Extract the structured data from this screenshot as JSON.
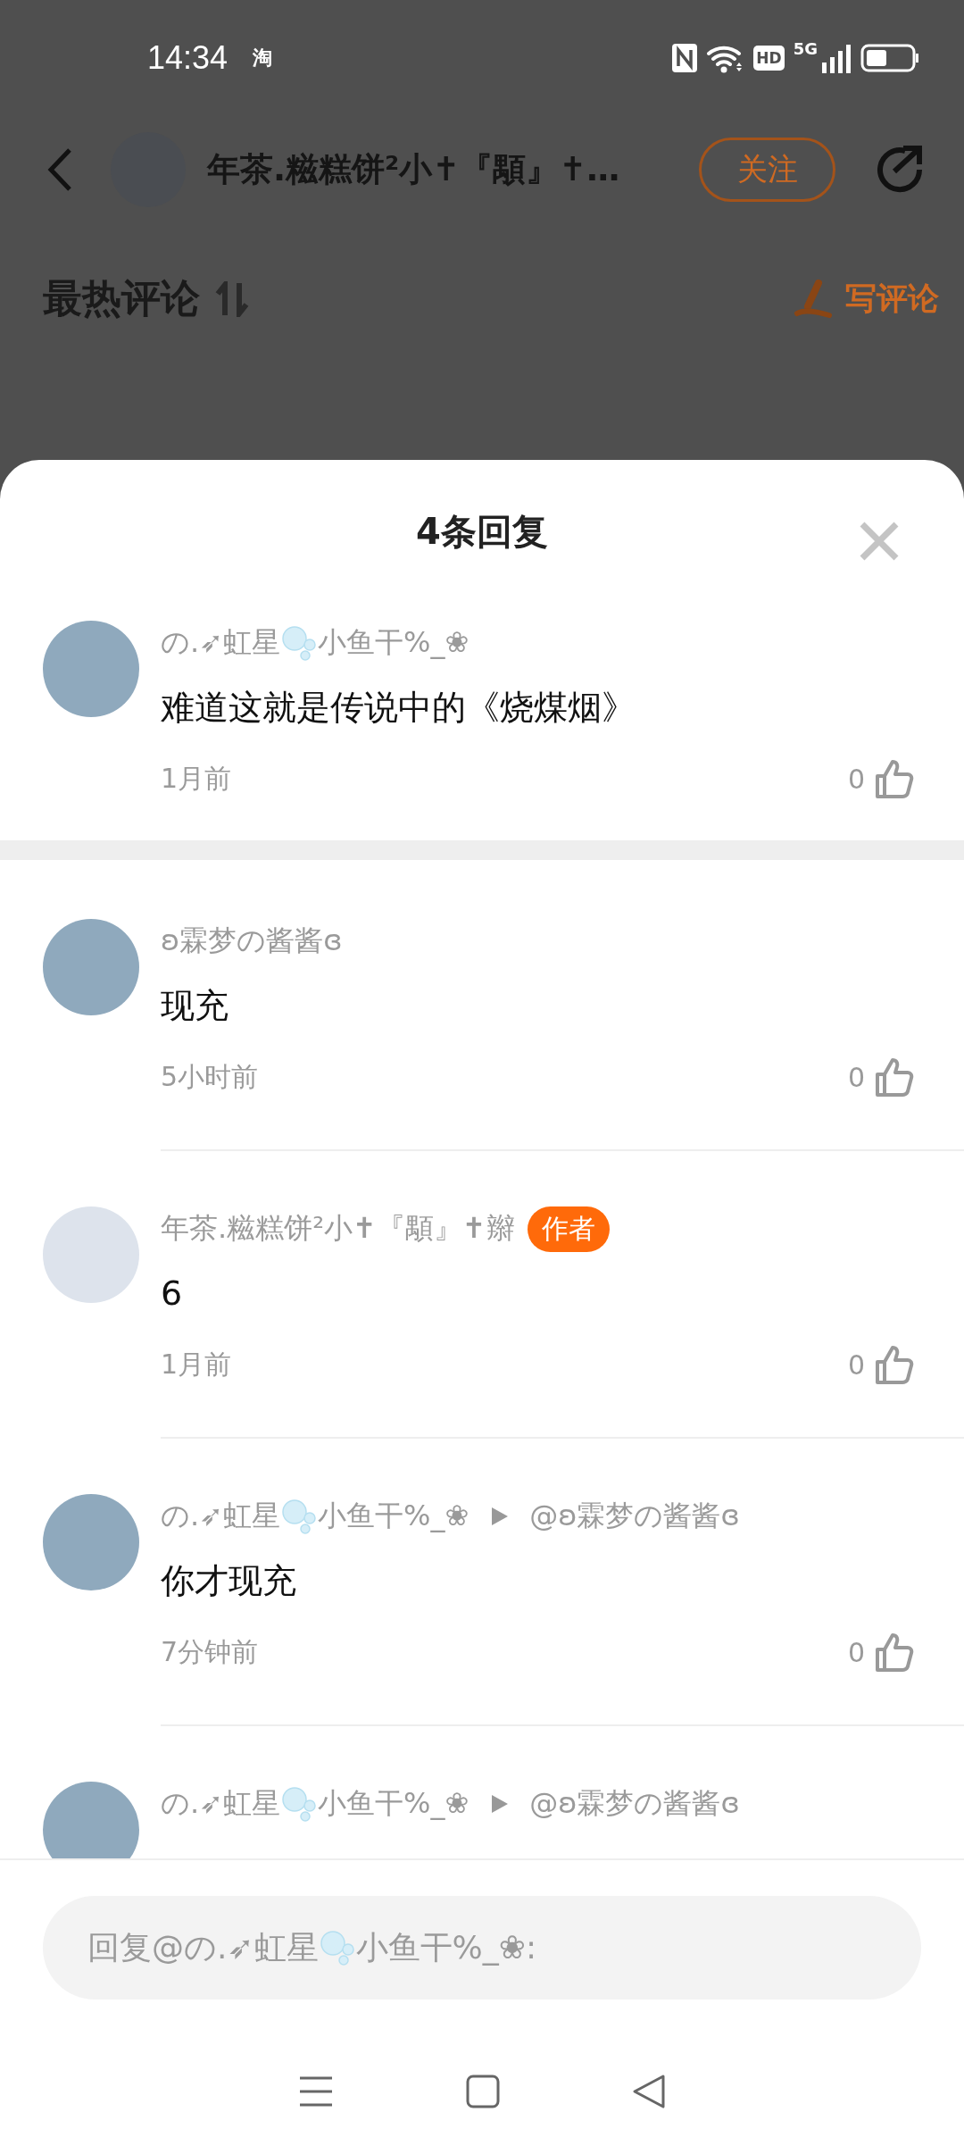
{
  "status_bar": {
    "time": "14:34",
    "app_badge": "淘",
    "network": "5G",
    "hd_label": "HD"
  },
  "header": {
    "title": "年茶.糍糕饼²小✝『顒』✝…",
    "follow_button": "关注"
  },
  "section": {
    "title": "最热评论",
    "write_button": "写评论"
  },
  "sheet": {
    "title": "4条回复"
  },
  "root_comment": {
    "has_photo": true,
    "name": [
      {
        "kind": "text",
        "text": "の.➶虹星"
      },
      {
        "kind": "bubble"
      },
      {
        "kind": "text",
        "text": "小鱼干%_❀"
      }
    ],
    "text": "难道这就是传说中的《烧煤烟》",
    "time": "1月前",
    "likes": "0"
  },
  "replies": [
    {
      "has_photo": true,
      "name": [
        {
          "kind": "text",
          "text": "ʚ霖梦の酱酱ɞ"
        }
      ],
      "text": "现充",
      "time": "5小时前",
      "likes": "0"
    },
    {
      "has_photo": false,
      "name": [
        {
          "kind": "text",
          "text": "年茶.糍糕饼²小✝『顒』✝辮"
        }
      ],
      "author_badge": "作者",
      "text": "6",
      "time": "1月前",
      "likes": "0"
    },
    {
      "has_photo": true,
      "name": [
        {
          "kind": "text",
          "text": "の.➶虹星"
        },
        {
          "kind": "bubble"
        },
        {
          "kind": "text",
          "text": "小鱼干%_❀"
        }
      ],
      "reply_to": "@ʚ霖梦の酱酱ɞ",
      "text": "你才现充",
      "time": "7分钟前",
      "likes": "0"
    },
    {
      "has_photo": true,
      "name": [
        {
          "kind": "text",
          "text": "の.➶虹星"
        },
        {
          "kind": "bubble"
        },
        {
          "kind": "text",
          "text": "小鱼干%_❀"
        }
      ],
      "reply_to": "@ʚ霖梦の酱酱ɞ"
    }
  ],
  "reply_field": {
    "placeholder": [
      {
        "kind": "text",
        "text": "回复@の.➶虹星"
      },
      {
        "kind": "bubble"
      },
      {
        "kind": "text",
        "text": "小鱼干%_❀:"
      }
    ]
  }
}
